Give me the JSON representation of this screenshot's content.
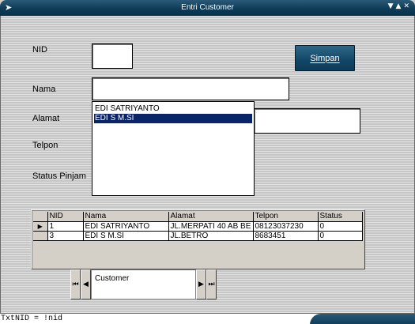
{
  "window": {
    "title": "Entri Customer",
    "icon": "app-icon",
    "controls": [
      "minimize-icon",
      "maximize-icon",
      "close-icon"
    ]
  },
  "labels": {
    "nid": "NID",
    "nama": "Nama",
    "alamat": "Alamat",
    "telpon": "Telpon",
    "status_pinjam": "Status Pinjam"
  },
  "inputs": {
    "nid": "",
    "nama": "",
    "alamat": ""
  },
  "buttons": {
    "simpan": "Simpan"
  },
  "dropdown": {
    "items": [
      "EDI SATRIYANTO",
      "EDI S M.SI"
    ],
    "selected_index": 1
  },
  "grid": {
    "columns": [
      "NID",
      "Nama",
      "Alamat",
      "Telpon",
      "Status"
    ],
    "rows": [
      {
        "nid": "1",
        "nama": "EDI SATRIYANTO",
        "alamat": "JL.MERPATI 40 AB BE",
        "telpon": "08123037230",
        "status": "0"
      },
      {
        "nid": "3",
        "nama": "EDI S M.SI",
        "alamat": "JL.BETRO",
        "telpon": "8683451",
        "status": "0"
      }
    ],
    "current_row": 0
  },
  "data_control": {
    "caption": "Customer"
  },
  "status_bar": {
    "text": "TxtNID = !nid"
  },
  "colors": {
    "accent": "#0e3c58",
    "selection": "#0a246a",
    "form_bg": "#d0d0d0"
  }
}
